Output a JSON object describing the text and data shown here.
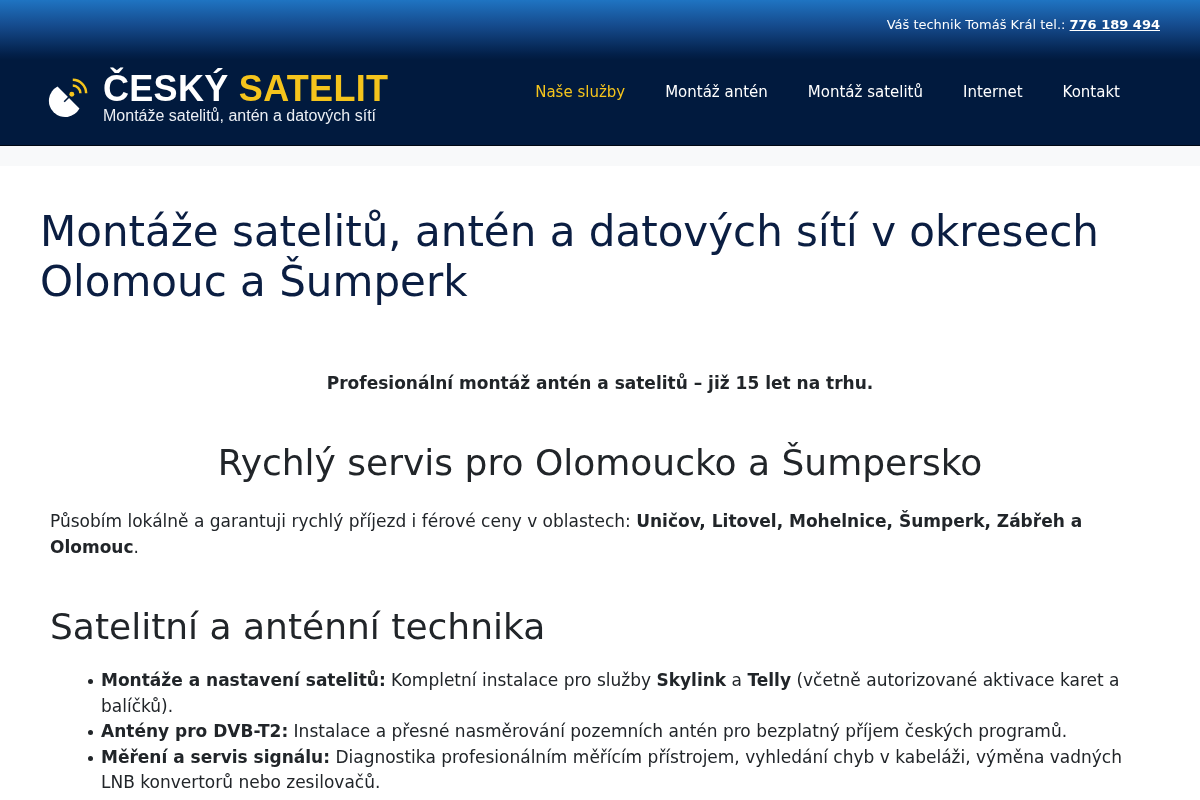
{
  "topbar": {
    "text": "Váš technik Tomáš Král tel.:",
    "phone": "776 189 494"
  },
  "logo": {
    "word_1": "ČESKÝ",
    "word_2": "SATELIT",
    "tagline": "Montáže satelitů, antén a datových sítí"
  },
  "nav": [
    {
      "label": "Naše služby",
      "selected": true
    },
    {
      "label": "Montáž antén",
      "selected": false
    },
    {
      "label": "Montáž satelitů",
      "selected": false
    },
    {
      "label": "Internet",
      "selected": false
    },
    {
      "label": "Kontakt",
      "selected": false
    }
  ],
  "page_title": "Montáže satelitů, antén a datových sítí v okresech Olomouc a Šumperk",
  "content": [
    {
      "kind": "tagline",
      "text": "Profesionální montáž antén a satelitů – již 15 let na trhu."
    },
    {
      "kind": "heading_center",
      "text": "Rychlý servis pro Olomoucko a Šumpersko"
    },
    {
      "kind": "paragraph",
      "text": "Působím lokálně a garantuji rychlý příjezd i férové ceny v oblastech: **Uničov, Litovel, Mohelnice, Šumperk, Zábřeh a Olomouc**."
    },
    {
      "kind": "heading",
      "text": "Satelitní a anténní technika"
    },
    {
      "kind": "list",
      "items": [
        "**Montáže a nastavení satelitů:** Kompletní instalace pro služby **Skylink** a **Telly** (včetně autorizované aktivace karet a balíčků).",
        "**Antény pro DVB-T2:** Instalace a přesné nasměrování pozemních antén pro bezplatný příjem českých programů.",
        "**Měření a servis signálu:** Diagnostika profesionálním měřícím přístrojem, vyhledání chyb v kabeláži, výměna vadných LNB konvertorů nebo zesilovačů."
      ]
    }
  ]
}
